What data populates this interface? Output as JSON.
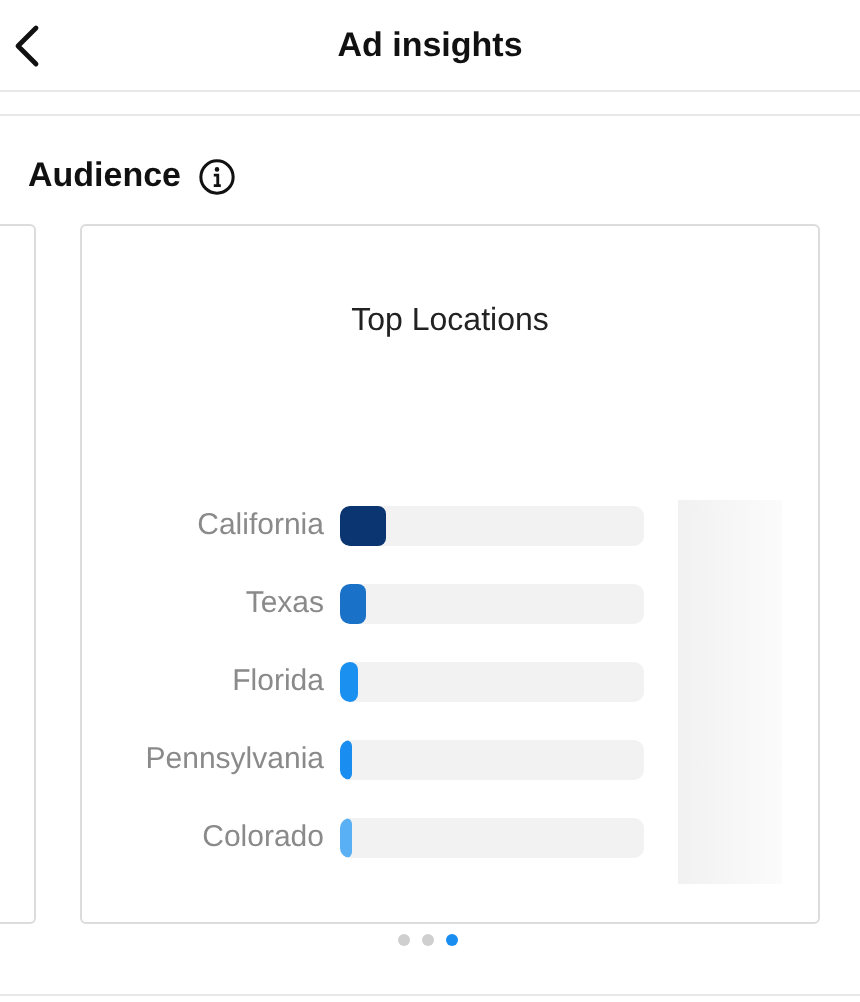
{
  "header": {
    "title": "Ad insights"
  },
  "section": {
    "title": "Audience"
  },
  "card": {
    "title": "Top Locations",
    "rows": [
      {
        "label": "California",
        "level": 0.15,
        "color": "#0a3570"
      },
      {
        "label": "Texas",
        "level": 0.085,
        "color": "#1a72c8"
      },
      {
        "label": "Florida",
        "level": 0.06,
        "color": "#1a90f0"
      },
      {
        "label": "Pennsylvania",
        "level": 0.04,
        "color": "#1a8ef0"
      },
      {
        "label": "Colorado",
        "level": 0.04,
        "color": "#5ab0f5"
      }
    ]
  },
  "pager": [
    {
      "selected": false
    },
    {
      "selected": false
    },
    {
      "selected": true
    }
  ]
}
